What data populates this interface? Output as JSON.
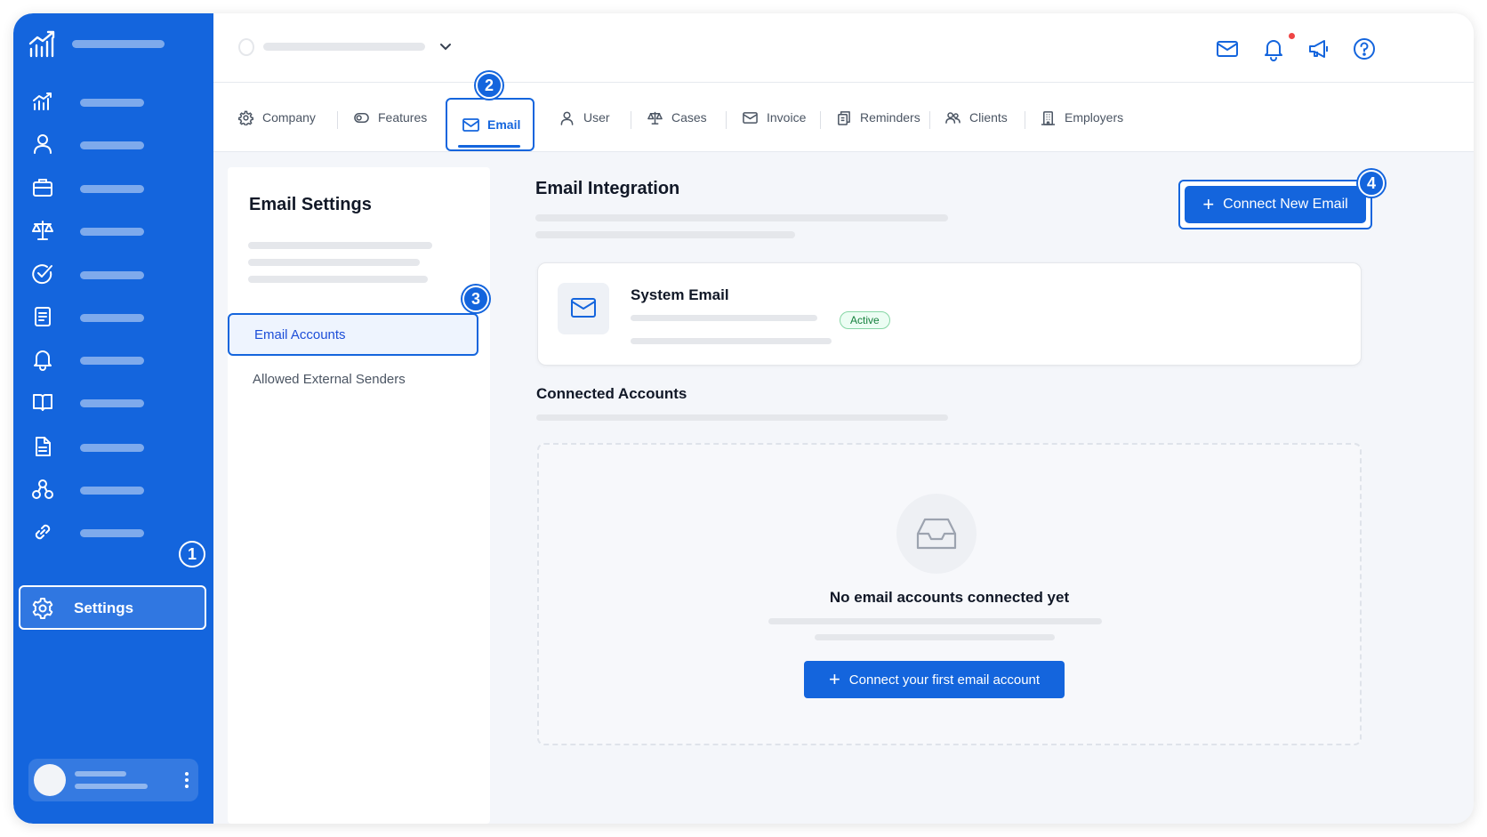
{
  "colors": {
    "brand": "#1465dd",
    "active_green": "#15803d",
    "notif_red": "#ef4444"
  },
  "sidebar": {
    "logo_icon": "chart-logo-icon",
    "items": [
      {
        "icon": "analytics-icon"
      },
      {
        "icon": "user-icon"
      },
      {
        "icon": "briefcase-icon"
      },
      {
        "icon": "scales-icon"
      },
      {
        "icon": "check-circle-icon"
      },
      {
        "icon": "document-icon"
      },
      {
        "icon": "bell-icon"
      },
      {
        "icon": "book-icon"
      },
      {
        "icon": "file-icon"
      },
      {
        "icon": "network-icon"
      },
      {
        "icon": "link-icon"
      }
    ],
    "settings_label": "Settings",
    "settings_badge": "1"
  },
  "topbar": {
    "icons": [
      "mail-icon",
      "bell-icon",
      "megaphone-icon",
      "help-icon"
    ]
  },
  "tabs": [
    {
      "label": "Company",
      "icon": "gear-icon"
    },
    {
      "label": "Features",
      "icon": "toggle-icon"
    },
    {
      "label": "Email",
      "icon": "mail-icon",
      "active": true
    },
    {
      "label": "User",
      "icon": "user-icon"
    },
    {
      "label": "Cases",
      "icon": "scales-icon"
    },
    {
      "label": "Invoice",
      "icon": "mail-icon"
    },
    {
      "label": "Reminders",
      "icon": "copy-icon"
    },
    {
      "label": "Clients",
      "icon": "users-icon"
    },
    {
      "label": "Employers",
      "icon": "building-icon"
    }
  ],
  "email_tab_badge": "2",
  "settings_panel": {
    "title": "Email Settings",
    "items": [
      "Email Accounts",
      "Allowed External Senders"
    ],
    "active_badge": "3"
  },
  "main": {
    "title": "Email Integration",
    "connect_button": "Connect New Email",
    "connect_badge": "4",
    "system_card": {
      "title": "System Email",
      "status": "Active"
    },
    "connected_title": "Connected Accounts",
    "empty": {
      "title": "No email accounts connected yet",
      "button": "Connect your first email account"
    }
  }
}
